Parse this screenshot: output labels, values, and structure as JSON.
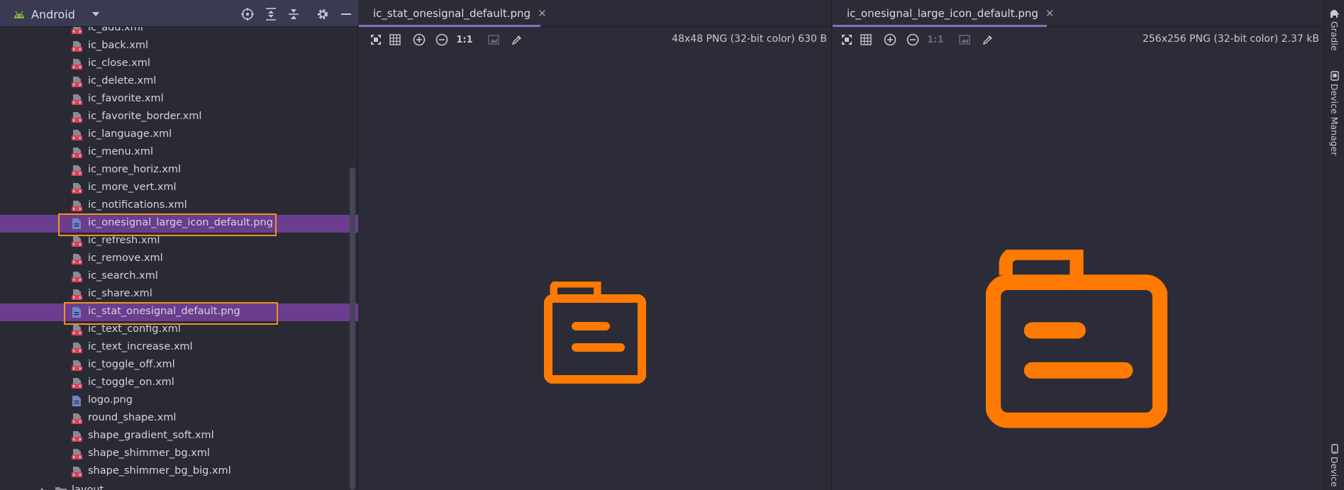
{
  "project_panel": {
    "view_selector": "Android",
    "files": [
      {
        "name": "ic_add.xml",
        "type": "xml"
      },
      {
        "name": "ic_back.xml",
        "type": "xml"
      },
      {
        "name": "ic_close.xml",
        "type": "xml"
      },
      {
        "name": "ic_delete.xml",
        "type": "xml"
      },
      {
        "name": "ic_favorite.xml",
        "type": "xml"
      },
      {
        "name": "ic_favorite_border.xml",
        "type": "xml"
      },
      {
        "name": "ic_language.xml",
        "type": "xml"
      },
      {
        "name": "ic_menu.xml",
        "type": "xml"
      },
      {
        "name": "ic_more_horiz.xml",
        "type": "xml"
      },
      {
        "name": "ic_more_vert.xml",
        "type": "xml"
      },
      {
        "name": "ic_notifications.xml",
        "type": "xml"
      },
      {
        "name": "ic_onesignal_large_icon_default.png",
        "type": "png",
        "selected": true
      },
      {
        "name": "ic_refresh.xml",
        "type": "xml"
      },
      {
        "name": "ic_remove.xml",
        "type": "xml"
      },
      {
        "name": "ic_search.xml",
        "type": "xml"
      },
      {
        "name": "ic_share.xml",
        "type": "xml"
      },
      {
        "name": "ic_stat_onesignal_default.png",
        "type": "png",
        "selected": true
      },
      {
        "name": "ic_text_config.xml",
        "type": "xml"
      },
      {
        "name": "ic_text_increase.xml",
        "type": "xml"
      },
      {
        "name": "ic_toggle_off.xml",
        "type": "xml"
      },
      {
        "name": "ic_toggle_on.xml",
        "type": "xml"
      },
      {
        "name": "logo.png",
        "type": "png"
      },
      {
        "name": "round_shape.xml",
        "type": "xml"
      },
      {
        "name": "shape_gradient_soft.xml",
        "type": "xml"
      },
      {
        "name": "shape_shimmer_bg.xml",
        "type": "xml"
      },
      {
        "name": "shape_shimmer_bg_big.xml",
        "type": "xml"
      }
    ],
    "folder": "layout"
  },
  "editor_left": {
    "tab_label": "ic_stat_onesignal_default.png",
    "image_info": "48x48 PNG (32-bit color) 630 B",
    "actual_size_label": "1:1"
  },
  "editor_right": {
    "tab_label": "ic_onesignal_large_icon_default.png",
    "image_info": "256x256 PNG (32-bit color) 2.37 kB",
    "actual_size_label": "1:1"
  },
  "tool_strip": {
    "items": [
      {
        "label": "Gradle",
        "icon": "elephant-icon"
      },
      {
        "label": "Device Manager",
        "icon": "device-manager-icon"
      },
      {
        "label": "Device",
        "icon": "device-icon"
      }
    ]
  },
  "colors": {
    "accent_orange": "#ff7a00",
    "selection_purple": "#6b3d8e",
    "highlight_box": "#f2921e",
    "xml_icon": "#d2455a",
    "png_icon": "#6d86c9"
  }
}
